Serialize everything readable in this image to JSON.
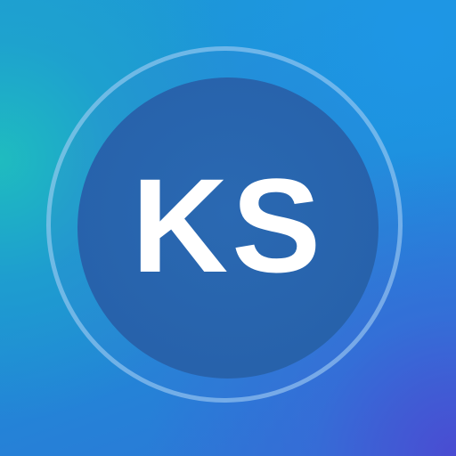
{
  "icon": {
    "monogram": "KS"
  },
  "colors": {
    "background_top_left": "#1fbcbf",
    "background_center": "#1c8ed8",
    "background_bottom_right": "#4a4cd2",
    "ring": "#afd7f5",
    "disc": "#2762ab",
    "text": "#ffffff"
  }
}
